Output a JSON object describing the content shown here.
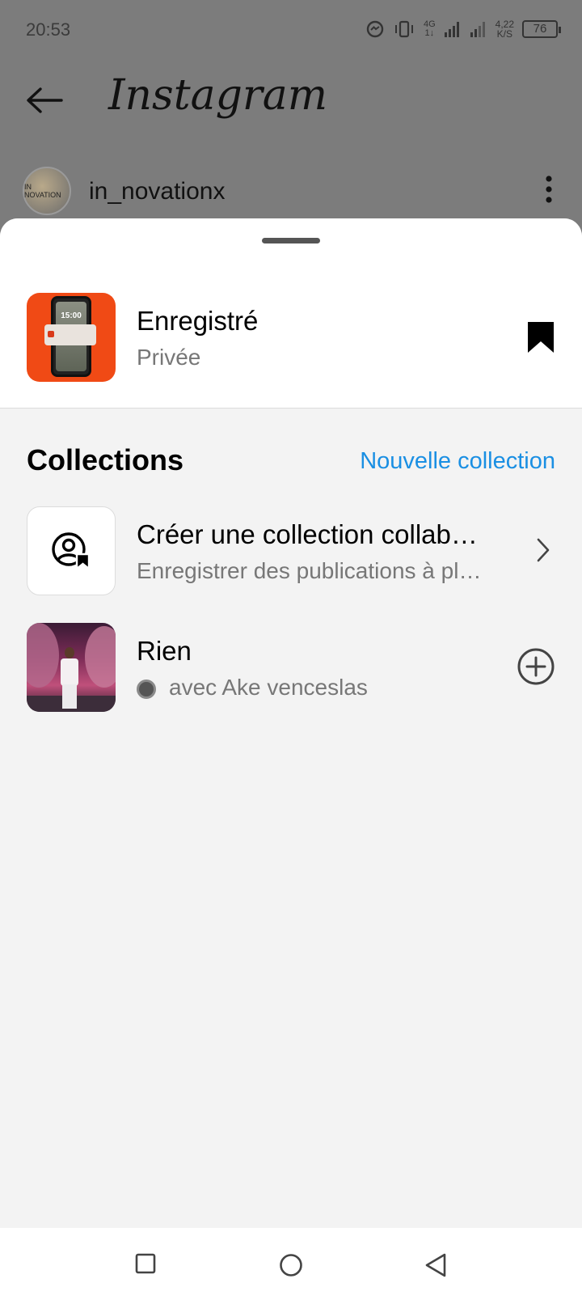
{
  "status_bar": {
    "time": "20:53",
    "network": "4G",
    "network_sub": "1↓",
    "speed_value": "4,22",
    "speed_unit": "K/S",
    "battery": "76"
  },
  "app": {
    "title": "Instagram",
    "profile": {
      "username": "in_novationx",
      "avatar_text": "IN NOVATION"
    }
  },
  "sheet": {
    "saved": {
      "title": "Enregistré",
      "subtitle": "Privée",
      "thumb_time": "15:00"
    },
    "collections": {
      "heading": "Collections",
      "new_label": "Nouvelle collection",
      "items": [
        {
          "title": "Créer une collection collaborative",
          "subtitle": "Enregistrer des publications à plusieurs"
        },
        {
          "title": "Rien",
          "subtitle": "avec Ake venceslas"
        }
      ]
    }
  },
  "icons": {
    "back": "arrow-left-icon",
    "more": "more-vertical-icon",
    "bookmark": "bookmark-filled-icon",
    "collab": "collab-user-bookmark-icon",
    "chevron": "chevron-right-icon",
    "add": "plus-circle-icon"
  },
  "colors": {
    "accent": "#1a8fe3",
    "saved_thumb_bg": "#f04a15",
    "dim_overlay": "#7c7c7c"
  }
}
